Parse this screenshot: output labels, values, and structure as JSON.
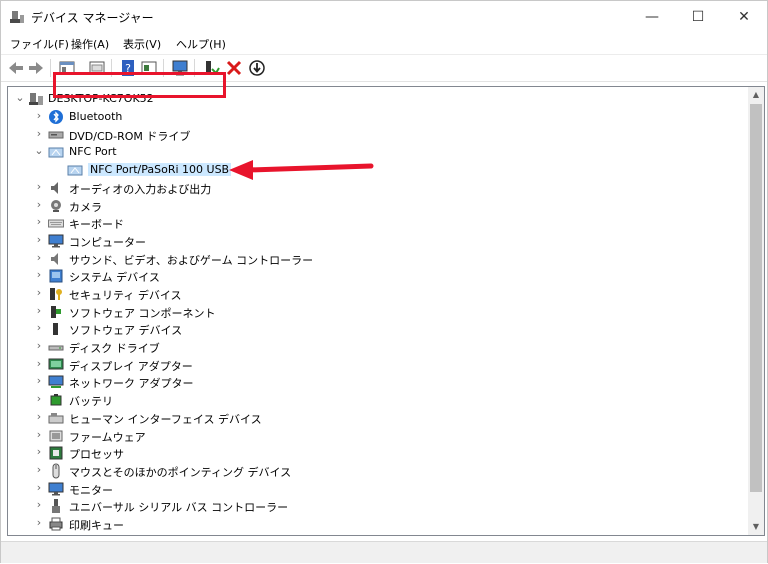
{
  "window": {
    "title": "デバイス マネージャー",
    "controls": {
      "minimize": "—",
      "maximize": "☐",
      "close": "✕"
    }
  },
  "menu": [
    {
      "label": "ファイル(F)"
    },
    {
      "label": "操作(A)"
    },
    {
      "label": "表示(V)"
    },
    {
      "label": "ヘルプ(H)"
    }
  ],
  "toolbar": {
    "buttons": [
      "back-icon",
      "forward-icon",
      "properties-view-icon",
      "show-hidden-icon",
      "help-icon",
      "console-tree-icon",
      "monitor-icon",
      "update-driver-icon",
      "uninstall-icon",
      "disable-device-icon"
    ]
  },
  "tree": {
    "root": "DESKTOP-KC7OK52",
    "items": [
      {
        "label": "Bluetooth",
        "icon": "bluetooth-icon"
      },
      {
        "label": "DVD/CD-ROM ドライブ",
        "icon": "optical-drive-icon"
      },
      {
        "label": "NFC Port",
        "icon": "nfc-icon",
        "expanded": true,
        "children": [
          {
            "label": "NFC Port/PaSoRi 100 USB",
            "icon": "nfc-icon",
            "selected": true
          }
        ]
      },
      {
        "label": "オーディオの入力および出力",
        "icon": "audio-icon"
      },
      {
        "label": "カメラ",
        "icon": "camera-icon"
      },
      {
        "label": "キーボード",
        "icon": "keyboard-icon"
      },
      {
        "label": "コンピューター",
        "icon": "computer-icon"
      },
      {
        "label": "サウンド、ビデオ、およびゲーム コントローラー",
        "icon": "sound-icon"
      },
      {
        "label": "システム デバイス",
        "icon": "system-device-icon"
      },
      {
        "label": "セキュリティ デバイス",
        "icon": "security-device-icon"
      },
      {
        "label": "ソフトウェア コンポーネント",
        "icon": "software-component-icon"
      },
      {
        "label": "ソフトウェア デバイス",
        "icon": "software-device-icon"
      },
      {
        "label": "ディスク ドライブ",
        "icon": "disk-drive-icon"
      },
      {
        "label": "ディスプレイ アダプター",
        "icon": "display-adapter-icon"
      },
      {
        "label": "ネットワーク アダプター",
        "icon": "network-adapter-icon"
      },
      {
        "label": "バッテリ",
        "icon": "battery-icon"
      },
      {
        "label": "ヒューマン インターフェイス デバイス",
        "icon": "hid-icon"
      },
      {
        "label": "ファームウェア",
        "icon": "firmware-icon"
      },
      {
        "label": "プロセッサ",
        "icon": "processor-icon"
      },
      {
        "label": "マウスとそのほかのポインティング デバイス",
        "icon": "mouse-icon"
      },
      {
        "label": "モニター",
        "icon": "monitor-icon"
      },
      {
        "label": "ユニバーサル シリアル バス コントローラー",
        "icon": "usb-icon"
      },
      {
        "label": "印刷キュー",
        "icon": "print-queue-icon"
      }
    ]
  },
  "colors": {
    "highlight": "#e8142c",
    "selection": "#cce8ff"
  }
}
